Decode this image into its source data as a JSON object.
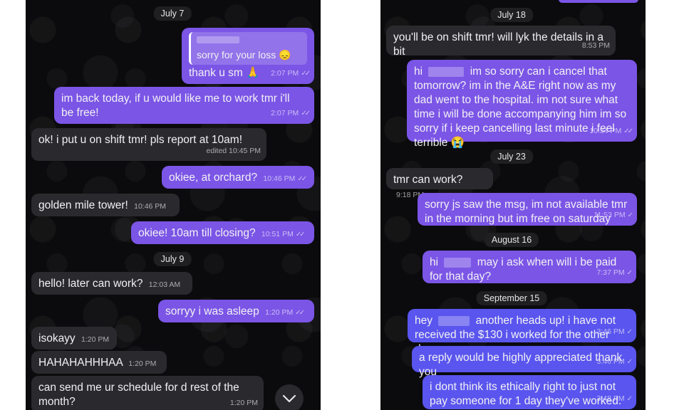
{
  "left": {
    "dates": [
      "July 7",
      "July 9"
    ],
    "messages": [
      {
        "quote": "sorry for your loss",
        "quote_emoji": "😞",
        "text": "thank u sm 🙏",
        "time": "2:07 PM",
        "dir": "out"
      },
      {
        "text": "im back today, if u would like me to work tmr i'll be free!",
        "time": "2:07 PM",
        "dir": "out"
      },
      {
        "text": "ok! i put u on shift tmr! pls report at 10am!",
        "time": "edited 10:45 PM",
        "dir": "in"
      },
      {
        "text": "okiee, at orchard?",
        "time": "10:46 PM",
        "dir": "out"
      },
      {
        "text": "golden mile tower!",
        "time": "10:46 PM",
        "dir": "in"
      },
      {
        "text": "okiee! 10am till closing?",
        "time": "10:51 PM",
        "dir": "out"
      },
      {
        "text": "hello! later can work?",
        "time": "12:03 AM",
        "dir": "in"
      },
      {
        "text": "sorryy i was asleep",
        "time": "1:20 PM",
        "dir": "out"
      },
      {
        "text": "isokayy",
        "time": "1:20 PM",
        "dir": "in"
      },
      {
        "text": "HAHAHAHHHAA",
        "time": "1:20 PM",
        "dir": "in"
      },
      {
        "text": "can send me ur schedule for d rest of the month?",
        "time": "1:20 PM",
        "dir": "in"
      }
    ],
    "scroll_icon": "chevron-down-icon"
  },
  "right": {
    "dates": [
      "July 18",
      "July 23",
      "August 16",
      "September 15"
    ],
    "messages": [
      {
        "text": "you'll be on shift tmr! will lyk the details in a bit",
        "time": "8:53 PM",
        "dir": "in"
      },
      {
        "text_a": "hi",
        "text_b": "im so sorry can i cancel that tomorrow? im in the A&E right now as my dad went to the hospital. im not sure what time i will be done accompanying him im so sorry if i keep cancelling last minute i feel terrible 😭",
        "time": "10:34 PM",
        "dir": "out"
      },
      {
        "text": "tmr can work?",
        "time": "9:18 PM",
        "dir": "in"
      },
      {
        "text": "sorry js saw the msg, im not available tmr in the morning but im free on saturday",
        "time": "11:53 PM",
        "dir": "out"
      },
      {
        "text_a": "hi",
        "text_b": "may i ask when will i be paid for that day?",
        "time": "7:37 PM",
        "dir": "out"
      },
      {
        "text_a": "hey",
        "text_b": "another heads up! i have not received the $130 i worked for the other day.",
        "time": "3:46 PM",
        "dir": "out"
      },
      {
        "text": "a reply would be highly appreciated thank you",
        "time": "3:46 PM",
        "dir": "out"
      },
      {
        "text": "i dont think its ethically right to just not pay someone for 1 day they've worked.",
        "time": "3:48 PM",
        "dir": "out"
      }
    ]
  },
  "colors": {
    "outgoing": "#7b55e6",
    "outgoing_alt": "#5a55ee",
    "incoming": "#2a2a2e",
    "background": "#0b0b0d"
  }
}
